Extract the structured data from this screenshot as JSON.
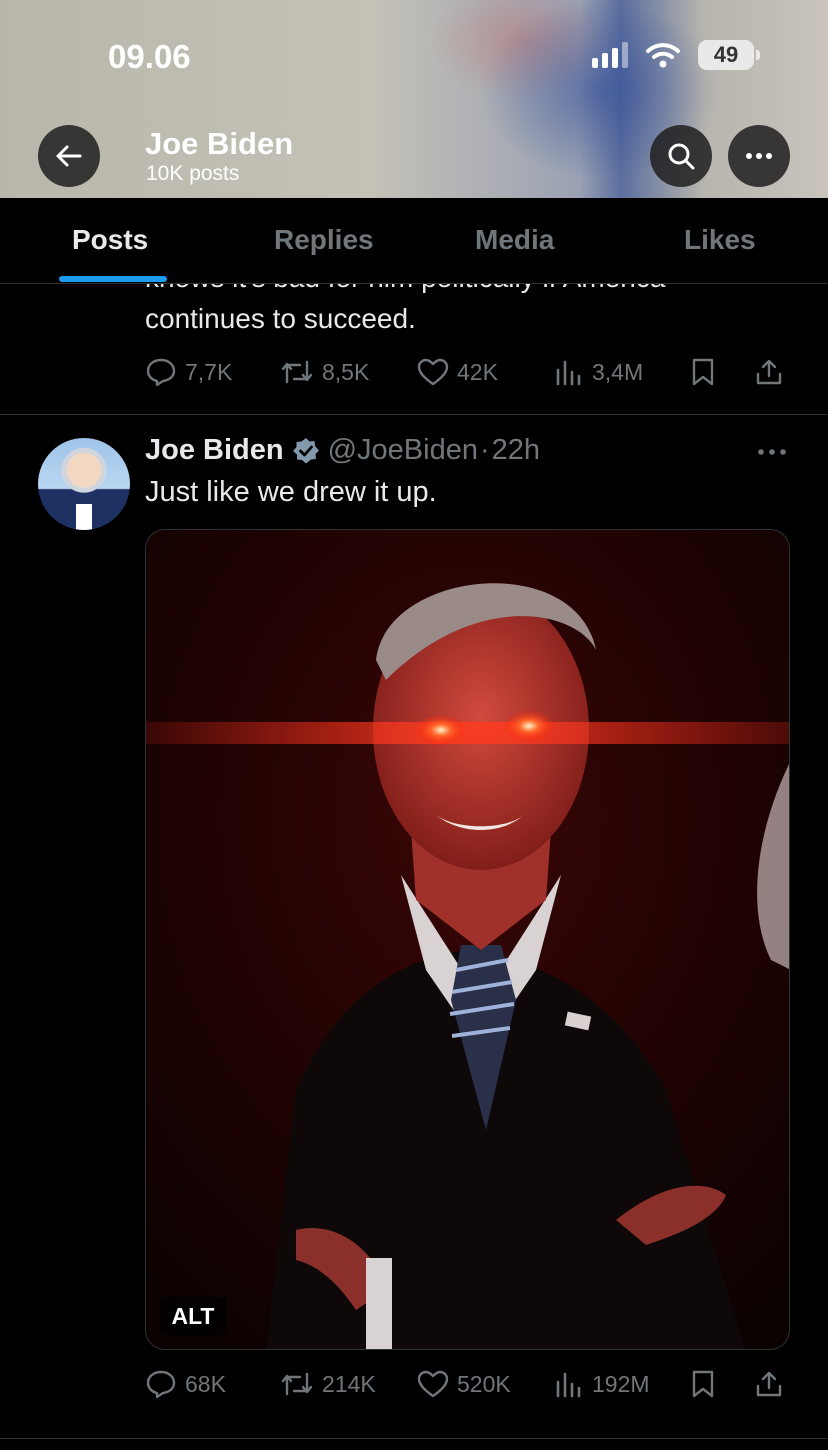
{
  "status_bar": {
    "time": "09.06",
    "battery": "49"
  },
  "header": {
    "title": "Joe Biden",
    "subtitle": "10K posts"
  },
  "tabs": [
    {
      "label": "Posts",
      "active": true
    },
    {
      "label": "Replies",
      "active": false
    },
    {
      "label": "Media",
      "active": false
    },
    {
      "label": "Likes",
      "active": false
    }
  ],
  "previous_tweet": {
    "cut_text": "knows it's bad for him politically if America",
    "text": "continues to succeed.",
    "replies": "7,7K",
    "reposts": "8,5K",
    "likes": "42K",
    "views": "3,4M"
  },
  "tweet": {
    "name": "Joe Biden",
    "handle": "@JoeBiden",
    "separator": "·",
    "time": "22h",
    "text": "Just like we drew it up.",
    "alt_label": "ALT",
    "replies": "68K",
    "reposts": "214K",
    "likes": "520K",
    "views": "192M"
  },
  "colors": {
    "accent": "#1d9bf0",
    "muted": "#71767b",
    "text": "#e7e9ea",
    "divider": "#2f3336"
  }
}
